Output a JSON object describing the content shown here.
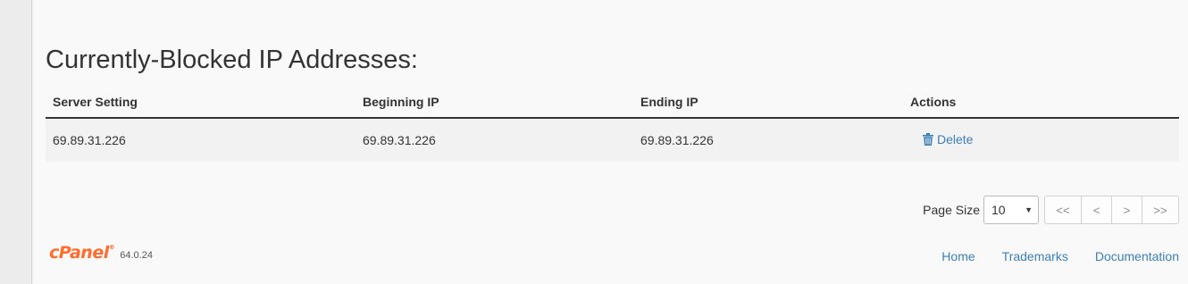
{
  "page": {
    "title": "Currently-Blocked IP Addresses:"
  },
  "table": {
    "headers": {
      "server_setting": "Server Setting",
      "beginning_ip": "Beginning IP",
      "ending_ip": "Ending IP",
      "actions": "Actions"
    },
    "rows": [
      {
        "server_setting": "69.89.31.226",
        "beginning_ip": "69.89.31.226",
        "ending_ip": "69.89.31.226",
        "action_label": "Delete",
        "action_icon": "trash-icon"
      }
    ]
  },
  "pager": {
    "page_size_label": "Page Size",
    "page_size_value": "10",
    "first_label": "<<",
    "prev_label": "<",
    "next_label": ">",
    "last_label": ">>"
  },
  "footer": {
    "logo_text": "cPanel",
    "version": "64.0.24",
    "links": {
      "home": "Home",
      "trademarks": "Trademarks",
      "documentation": "Documentation"
    }
  },
  "colors": {
    "link": "#3a7fb8",
    "brand": "#ff6c2c",
    "background": "#f9f9f9"
  }
}
